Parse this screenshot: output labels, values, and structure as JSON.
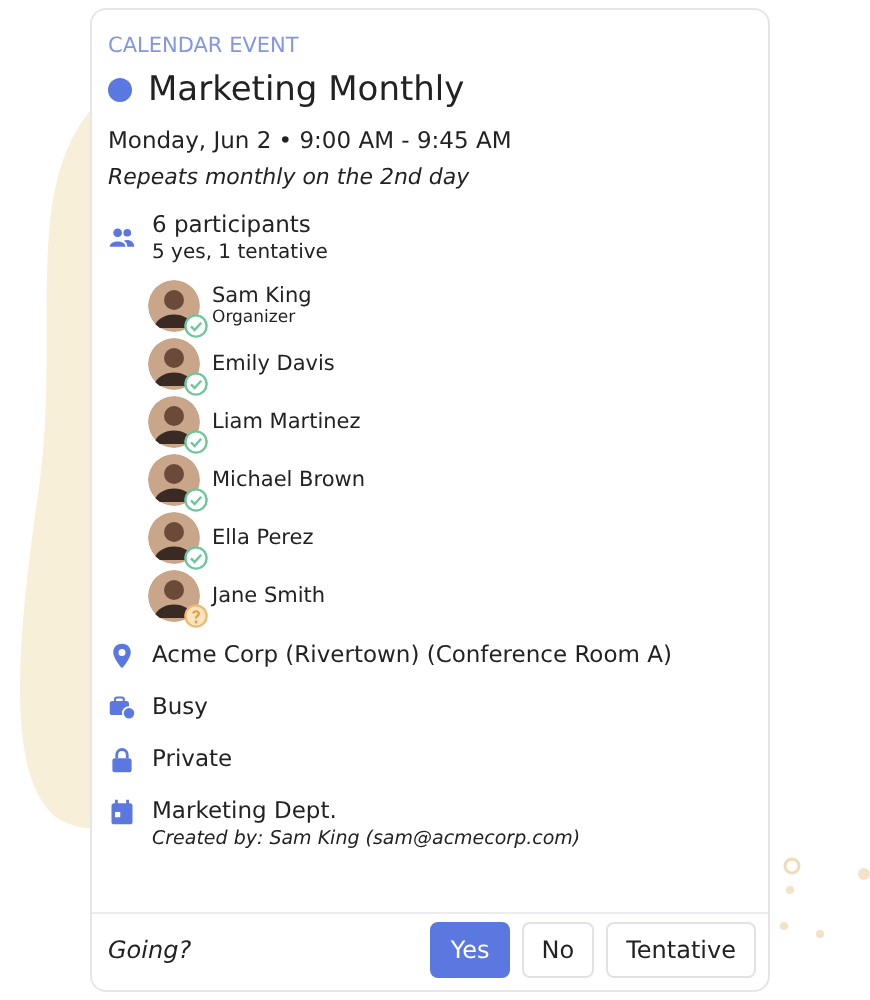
{
  "header": {
    "label": "CALENDAR EVENT"
  },
  "event": {
    "title": "Marketing Monthly",
    "color": "#5b78e0",
    "when": "Monday, Jun 2 • 9:00 AM - 9:45 AM",
    "recurrence": "Repeats monthly on the 2nd day"
  },
  "participants": {
    "count": "6 participants",
    "summary": "5 yes, 1 tentative",
    "people": [
      {
        "name": "Sam King",
        "role": "Organizer",
        "accepted": true
      },
      {
        "name": "Emily Davis",
        "accepted": true
      },
      {
        "name": "Liam Martinez",
        "accepted": true
      },
      {
        "name": "Michael Brown",
        "accepted": true
      },
      {
        "name": "Ella Perez",
        "accepted": true
      },
      {
        "name": "Jane Smith",
        "accepted": false
      }
    ]
  },
  "details": [
    {
      "kind": "location",
      "text": "Acme Corp (Rivertown) (Conference Room A)"
    },
    {
      "kind": "availability",
      "text": "Busy"
    },
    {
      "kind": "visibility",
      "text": "Private"
    },
    {
      "kind": "calendar",
      "text": "Marketing Dept.",
      "note": "Created by: Sam King (sam@acmecorp.com)"
    }
  ],
  "rsvp": {
    "prompt": "Going?",
    "options": [
      {
        "label": "Yes",
        "selected": true
      },
      {
        "label": "No",
        "selected": false
      },
      {
        "label": "Tentative",
        "selected": false
      }
    ]
  }
}
